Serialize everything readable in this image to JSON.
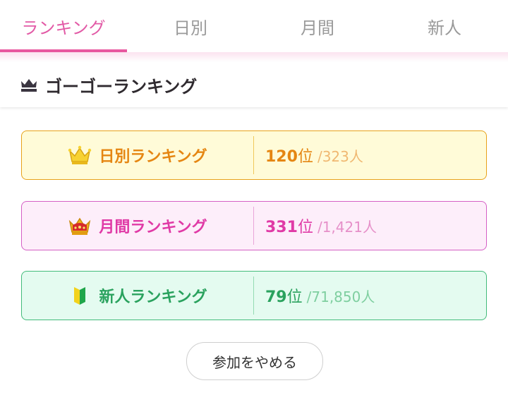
{
  "tabs": [
    {
      "label": "ランキング",
      "active": true
    },
    {
      "label": "日別",
      "active": false
    },
    {
      "label": "月間",
      "active": false
    },
    {
      "label": "新人",
      "active": false
    }
  ],
  "section": {
    "title": "ゴーゴーランキング",
    "icon": "crown-icon"
  },
  "rankings": {
    "daily": {
      "label": "日別ランキング",
      "icon": "gold-crown-icon",
      "rank": "120",
      "rank_unit": "位",
      "total": "/323人"
    },
    "monthly": {
      "label": "月間ランキング",
      "icon": "red-jeweled-crown-icon",
      "rank": "331",
      "rank_unit": "位",
      "total": "/1,421人"
    },
    "newbie": {
      "label": "新人ランキング",
      "icon": "beginner-mark-icon",
      "rank": "79",
      "rank_unit": "位",
      "total": "/71,850人"
    }
  },
  "quit_button": {
    "label": "参加をやめる"
  },
  "colors": {
    "accent": "#e8589f",
    "daily": "#e58612",
    "monthly": "#e03aa6",
    "newbie": "#2aa25e"
  }
}
